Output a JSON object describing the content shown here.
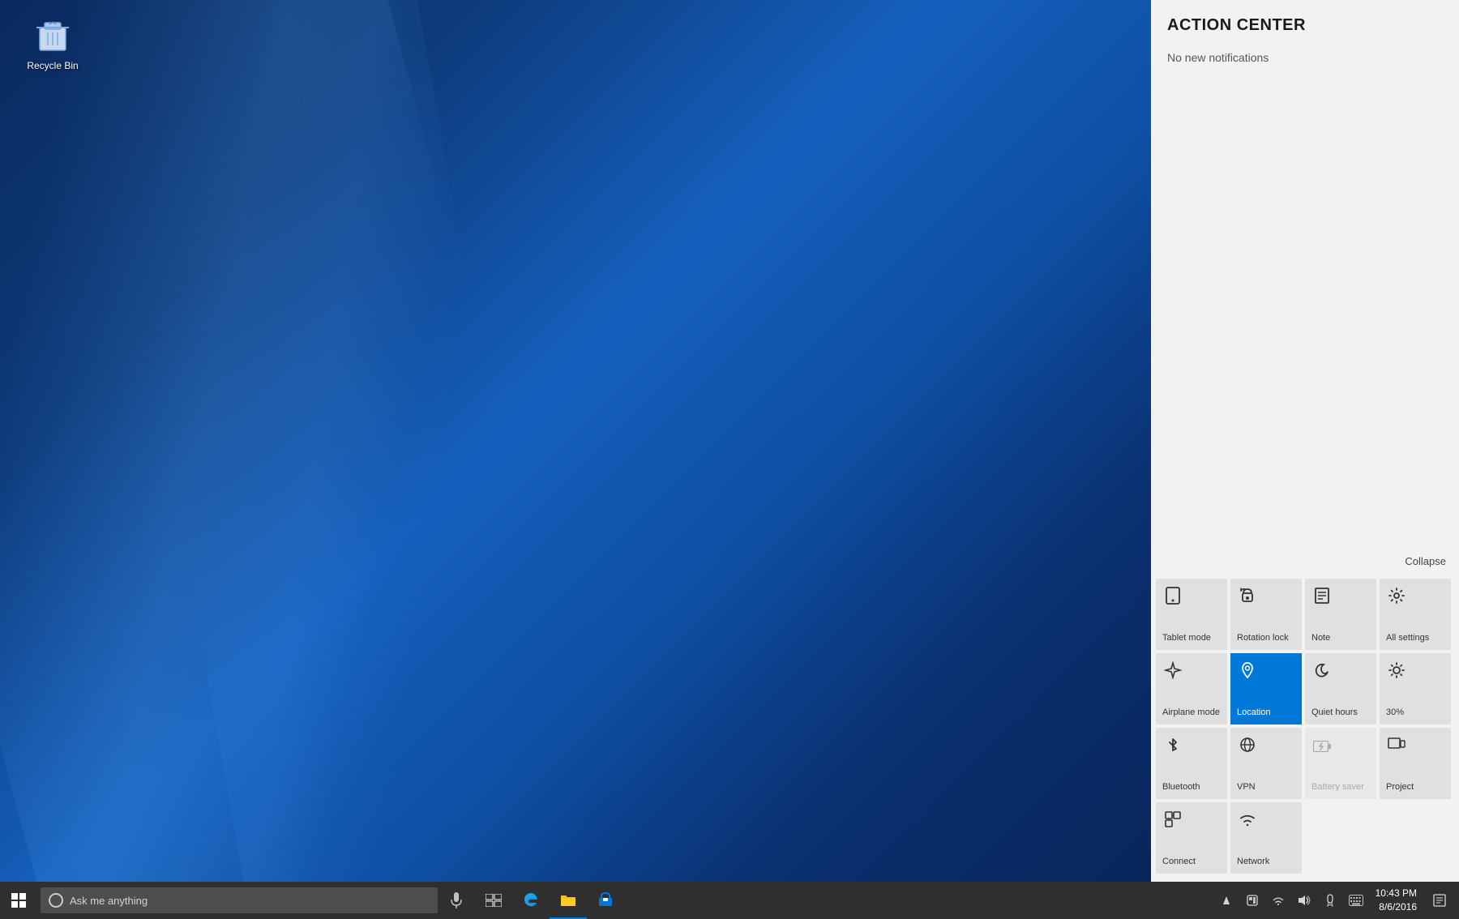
{
  "desktop": {
    "recycle_bin_label": "Recycle Bin"
  },
  "action_center": {
    "title": "ACTION CENTER",
    "no_notifications": "No new notifications",
    "collapse_label": "Collapse",
    "quick_actions": [
      [
        {
          "id": "tablet-mode",
          "label": "Tablet mode",
          "icon": "⊞",
          "active": false,
          "disabled": false
        },
        {
          "id": "rotation-lock",
          "label": "Rotation lock",
          "icon": "🔒",
          "active": false,
          "disabled": false
        },
        {
          "id": "note",
          "label": "Note",
          "icon": "☐",
          "active": false,
          "disabled": false
        },
        {
          "id": "all-settings",
          "label": "All settings",
          "icon": "⚙",
          "active": false,
          "disabled": false
        }
      ],
      [
        {
          "id": "airplane-mode",
          "label": "Airplane mode",
          "icon": "✈",
          "active": false,
          "disabled": false
        },
        {
          "id": "location",
          "label": "Location",
          "icon": "📍",
          "active": true,
          "disabled": false
        },
        {
          "id": "quiet-hours",
          "label": "Quiet hours",
          "icon": "🌙",
          "active": false,
          "disabled": false
        },
        {
          "id": "brightness-30",
          "label": "30%",
          "icon": "☀",
          "active": false,
          "disabled": false
        }
      ],
      [
        {
          "id": "bluetooth",
          "label": "Bluetooth",
          "icon": "₿",
          "active": false,
          "disabled": false
        },
        {
          "id": "vpn",
          "label": "VPN",
          "icon": "⚭",
          "active": false,
          "disabled": false
        },
        {
          "id": "battery-saver",
          "label": "Battery saver",
          "icon": "◇",
          "active": false,
          "disabled": true
        },
        {
          "id": "project",
          "label": "Project",
          "icon": "▭",
          "active": false,
          "disabled": false
        }
      ],
      [
        {
          "id": "connect",
          "label": "Connect",
          "icon": "⊡",
          "active": false,
          "disabled": false
        },
        {
          "id": "network",
          "label": "Network",
          "icon": "📶",
          "active": false,
          "disabled": false
        }
      ]
    ]
  },
  "taskbar": {
    "search_placeholder": "Ask me anything",
    "time": "10:43 PM",
    "date": "8/6/2016",
    "apps": [
      {
        "id": "start",
        "label": "Start"
      },
      {
        "id": "search"
      },
      {
        "id": "cortana-mic"
      },
      {
        "id": "task-view"
      },
      {
        "id": "edge"
      },
      {
        "id": "file-explorer"
      },
      {
        "id": "store"
      }
    ]
  }
}
